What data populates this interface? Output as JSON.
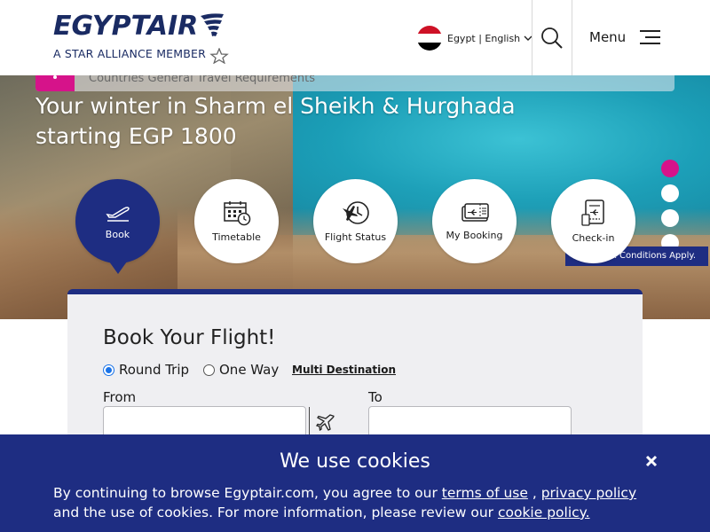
{
  "header": {
    "logo_text": "EGYPTAIR",
    "logo_tagline": "A STAR ALLIANCE MEMBER",
    "language": "Egypt | English",
    "menu_label": "Menu"
  },
  "hero": {
    "notice_text": "Countries General Travel Requirements",
    "title_line1": "Your winter in Sharm el Sheikh & Hurghada",
    "title_line2": "starting EGP 1800",
    "terms_text": "& Conditions Apply.",
    "slides": 4,
    "active_slide": 1
  },
  "nav": [
    {
      "label": "Book",
      "icon": "plane-takeoff-icon",
      "active": true
    },
    {
      "label": "Timetable",
      "icon": "calendar-clock-icon",
      "active": false
    },
    {
      "label": "Flight Status",
      "icon": "plane-clock-icon",
      "active": false
    },
    {
      "label": "My Booking",
      "icon": "ticket-icon",
      "active": false
    },
    {
      "label": "Check-in",
      "icon": "boarding-pass-icon",
      "active": false
    }
  ],
  "booking": {
    "title": "Book Your Flight!",
    "round_trip": "Round Trip",
    "one_way": "One Way",
    "multi_destination": "Multi Destination",
    "selected_trip": "round_trip",
    "from_label": "From",
    "to_label": "To",
    "from_value": "",
    "to_value": ""
  },
  "cookies": {
    "title": "We use cookies",
    "text_1": "By continuing to browse Egyptair.com, you agree to our ",
    "terms_link": "terms of use",
    "text_2": " , ",
    "privacy_link": "privacy policy",
    "text_3": " and the use of cookies. For more information, please review our ",
    "cookie_link": "cookie policy."
  },
  "colors": {
    "brand_navy": "#1e2d82",
    "accent_pink": "#d6138a",
    "logo_navy": "#1a2b63"
  }
}
